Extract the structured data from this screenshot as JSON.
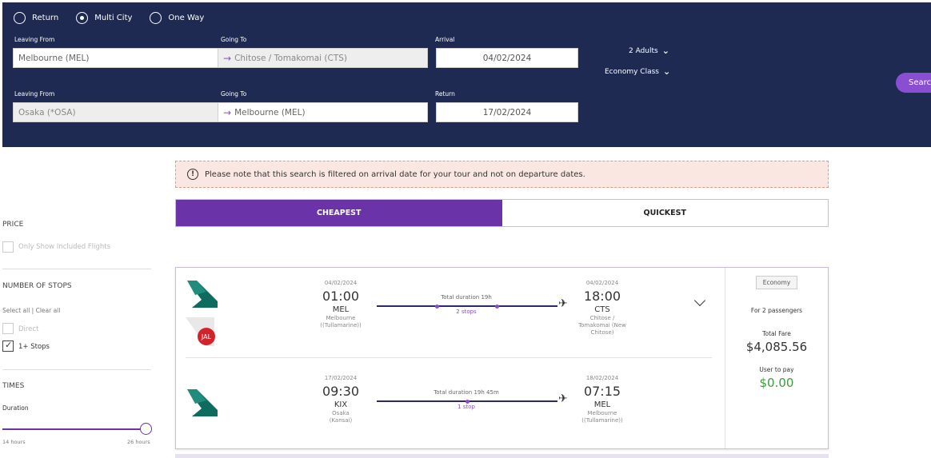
{
  "trip_types": [
    {
      "label": "Return",
      "selected": false
    },
    {
      "label": "Multi City",
      "selected": true
    },
    {
      "label": "One Way",
      "selected": false
    }
  ],
  "search": {
    "leg1": {
      "leaving_label": "Leaving From",
      "leaving_value": "Melbourne (MEL)",
      "going_label": "Going To",
      "going_value": "Chitose / Tomakomai (CTS)",
      "date_label": "Arrival",
      "date_value": "04/02/2024"
    },
    "leg2": {
      "leaving_label": "Leaving From",
      "leaving_value": "Osaka (*OSA)",
      "going_label": "Going To",
      "going_value": "Melbourne (MEL)",
      "date_label": "Return",
      "date_value": "17/02/2024"
    },
    "passengers": "2 Adults",
    "cabin": "Economy Class",
    "search_label": "Search"
  },
  "notice": "Please note that this search is filtered on arrival date for your tour and not on departure dates.",
  "tabs": {
    "cheapest": "CHEAPEST",
    "quickest": "QUICKEST"
  },
  "filters": {
    "price_heading": "PRICE",
    "included_label": "Only Show Included Flights",
    "stops_heading": "NUMBER OF STOPS",
    "select_all": "Select all | Clear all",
    "direct_label": "Direct",
    "one_plus_label": "1+ Stops",
    "times_heading": "TIMES",
    "duration_label": "Duration",
    "duration_min": "14 hours",
    "duration_max": "26 hours"
  },
  "result": {
    "outbound": {
      "dep_date": "04/02/2024",
      "dep_time": "01:00",
      "dep_code": "MEL",
      "dep_city": "Melbourne ((Tullamarine))",
      "duration": "Total duration 19h",
      "stops": "2 stops",
      "arr_date": "04/02/2024",
      "arr_time": "18:00",
      "arr_code": "CTS",
      "arr_city": "Chitose / Tomakomai (New Chitose)"
    },
    "inbound": {
      "dep_date": "17/02/2024",
      "dep_time": "09:30",
      "dep_code": "KIX",
      "dep_city": "Osaka (Kansai)",
      "duration": "Total duration 19h 45m",
      "stops": "1 stop",
      "arr_date": "18/02/2024",
      "arr_time": "07:15",
      "arr_code": "MEL",
      "arr_city": "Melbourne ((Tullamarine))"
    },
    "cabin_badge": "Economy",
    "for_passengers": "For 2 passengers",
    "total_fare_label": "Total Fare",
    "total_fare": "$4,085.56",
    "user_to_pay_label": "User to pay",
    "user_to_pay": "$0.00"
  },
  "colors": {
    "navy": "#1f2a52",
    "purple": "#6a34a8",
    "accent": "#8a4fd0",
    "green": "#3a9b3a"
  }
}
